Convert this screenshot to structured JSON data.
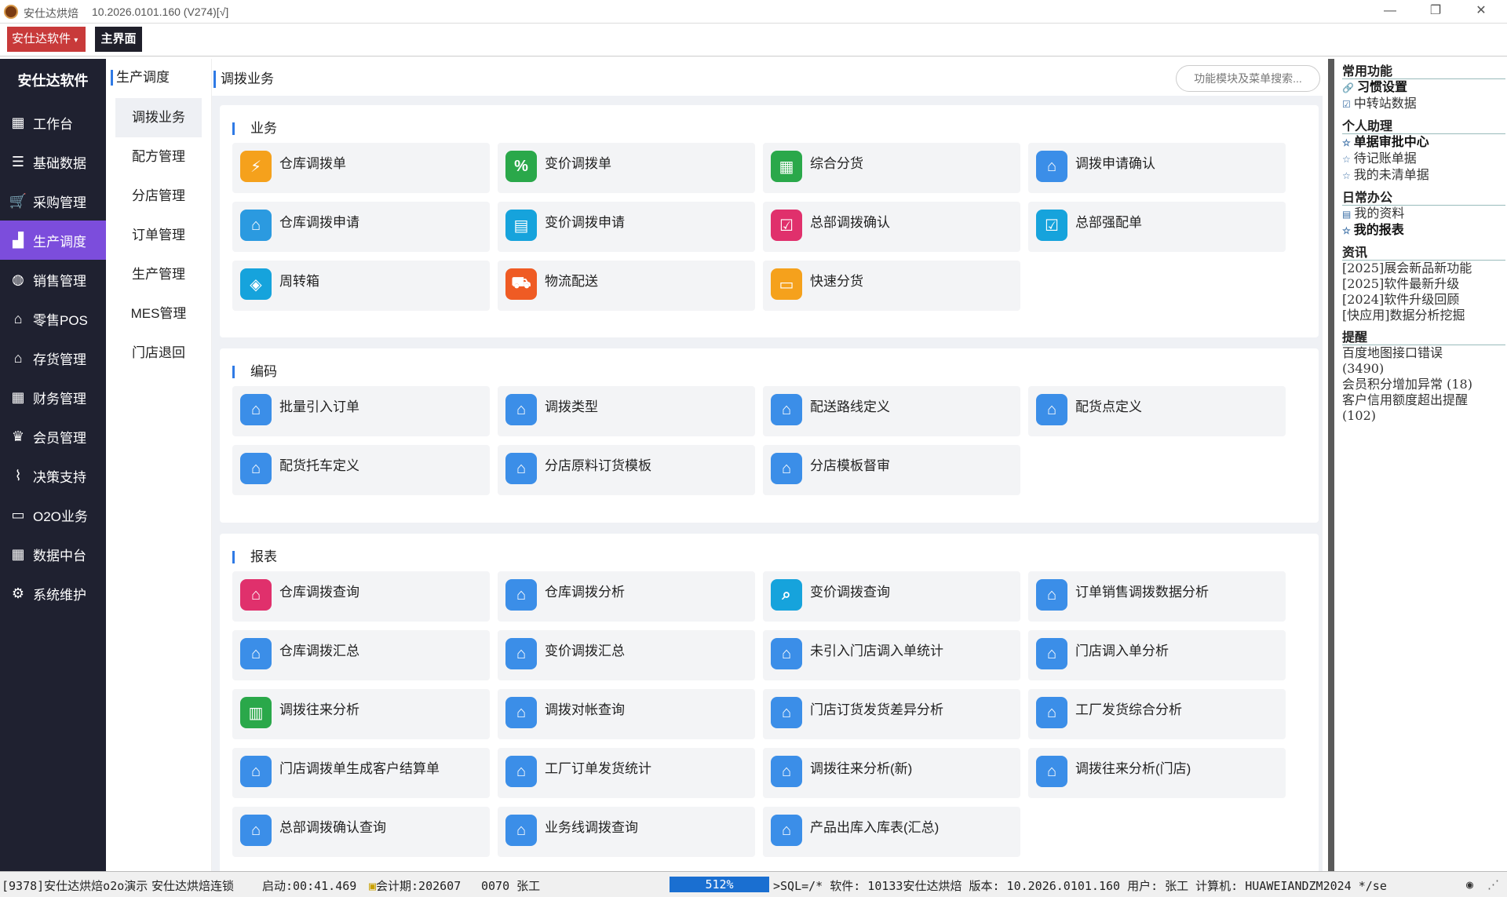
{
  "window": {
    "title": "安仕达烘焙",
    "version": "10.2026.0101.160 (V274)[√]"
  },
  "toolbar": {
    "menu_label": "安仕达软件",
    "home_tab": "主界面"
  },
  "sidebar": {
    "brand": "安仕达软件",
    "items": [
      {
        "label": "工作台",
        "icon": "grid-icon"
      },
      {
        "label": "基础数据",
        "icon": "database-icon"
      },
      {
        "label": "采购管理",
        "icon": "cart-icon"
      },
      {
        "label": "生产调度",
        "icon": "factory-icon"
      },
      {
        "label": "销售管理",
        "icon": "sale-icon"
      },
      {
        "label": "零售POS",
        "icon": "store-icon"
      },
      {
        "label": "存货管理",
        "icon": "warehouse-icon"
      },
      {
        "label": "财务管理",
        "icon": "grid-icon"
      },
      {
        "label": "会员管理",
        "icon": "crown-icon"
      },
      {
        "label": "决策支持",
        "icon": "chart-icon"
      },
      {
        "label": "O2O业务",
        "icon": "monitor-icon"
      },
      {
        "label": "数据中台",
        "icon": "grid-icon"
      },
      {
        "label": "系统维护",
        "icon": "gear-icon"
      }
    ],
    "active_color": "#7c4ddc"
  },
  "subnav": {
    "header": "生产调度",
    "items": [
      "调拨业务",
      "配方管理",
      "分店管理",
      "订单管理",
      "生产管理",
      "MES管理",
      "门店退回"
    ]
  },
  "main": {
    "header": "调拨业务",
    "search_placeholder": "功能模块及菜单搜索...",
    "sections": [
      {
        "title": "业务",
        "cards": [
          {
            "label": "仓库调拨单",
            "color": "#f5a11c",
            "glyph": "⚡"
          },
          {
            "label": "变价调拨单",
            "color": "#2aa84a",
            "glyph": "%"
          },
          {
            "label": "综合分货",
            "color": "#2aa84a",
            "glyph": "▦"
          },
          {
            "label": "调拨申请确认",
            "color": "#3b8ee8",
            "glyph": "⌂"
          },
          {
            "label": "仓库调拨申请",
            "color": "#2b9ae0",
            "glyph": "⌂"
          },
          {
            "label": "变价调拨申请",
            "color": "#16a3dc",
            "glyph": "▤"
          },
          {
            "label": "总部调拨确认",
            "color": "#e0306c",
            "glyph": "☑"
          },
          {
            "label": "总部强配单",
            "color": "#16a3dc",
            "glyph": "☑"
          },
          {
            "label": "周转箱",
            "color": "#16a3dc",
            "glyph": "◈"
          },
          {
            "label": "物流配送",
            "color": "#ef5b24",
            "glyph": "⛟"
          },
          {
            "label": "快速分货",
            "color": "#f5a11c",
            "glyph": "▭"
          }
        ]
      },
      {
        "title": "编码",
        "cards": [
          {
            "label": "批量引入订单",
            "color": "#3b8ee8",
            "glyph": "⌂"
          },
          {
            "label": "调拨类型",
            "color": "#3b8ee8",
            "glyph": "⌂"
          },
          {
            "label": "配送路线定义",
            "color": "#3b8ee8",
            "glyph": "⌂"
          },
          {
            "label": "配货点定义",
            "color": "#3b8ee8",
            "glyph": "⌂"
          },
          {
            "label": "配货托车定义",
            "color": "#3b8ee8",
            "glyph": "⌂"
          },
          {
            "label": "分店原料订货模板",
            "color": "#3b8ee8",
            "glyph": "⌂"
          },
          {
            "label": "分店模板督审",
            "color": "#3b8ee8",
            "glyph": "⌂"
          }
        ]
      },
      {
        "title": "报表",
        "cards": [
          {
            "label": "仓库调拨查询",
            "color": "#e0306c",
            "glyph": "⌂"
          },
          {
            "label": "仓库调拨分析",
            "color": "#3b8ee8",
            "glyph": "⌂"
          },
          {
            "label": "变价调拨查询",
            "color": "#16a3dc",
            "glyph": "⌕"
          },
          {
            "label": "订单销售调拨数据分析",
            "color": "#3b8ee8",
            "glyph": "⌂"
          },
          {
            "label": "仓库调拨汇总",
            "color": "#3b8ee8",
            "glyph": "⌂"
          },
          {
            "label": "变价调拨汇总",
            "color": "#3b8ee8",
            "glyph": "⌂"
          },
          {
            "label": "未引入门店调入单统计",
            "color": "#3b8ee8",
            "glyph": "⌂"
          },
          {
            "label": "门店调入单分析",
            "color": "#3b8ee8",
            "glyph": "⌂"
          },
          {
            "label": "调拨往来分析",
            "color": "#2aa84a",
            "glyph": "▥"
          },
          {
            "label": "调拨对帐查询",
            "color": "#3b8ee8",
            "glyph": "⌂"
          },
          {
            "label": "门店订货发货差异分析",
            "color": "#3b8ee8",
            "glyph": "⌂"
          },
          {
            "label": "工厂发货综合分析",
            "color": "#3b8ee8",
            "glyph": "⌂"
          },
          {
            "label": "门店调拨单生成客户结算单",
            "color": "#3b8ee8",
            "glyph": "⌂"
          },
          {
            "label": "工厂订单发货统计",
            "color": "#3b8ee8",
            "glyph": "⌂"
          },
          {
            "label": "调拨往来分析(新)",
            "color": "#3b8ee8",
            "glyph": "⌂"
          },
          {
            "label": "调拨往来分析(门店)",
            "color": "#3b8ee8",
            "glyph": "⌂"
          },
          {
            "label": "总部调拨确认查询",
            "color": "#3b8ee8",
            "glyph": "⌂"
          },
          {
            "label": "业务线调拨查询",
            "color": "#3b8ee8",
            "glyph": "⌂"
          },
          {
            "label": "产品出库入库表(汇总)",
            "color": "#3b8ee8",
            "glyph": "⌂"
          }
        ]
      }
    ]
  },
  "rightpanel": {
    "common": {
      "title": "常用功能",
      "items": [
        "习惯设置",
        "中转站数据"
      ]
    },
    "assistant": {
      "title": "个人助理",
      "items": [
        "单据审批中心",
        "待记账单据",
        "我的未清单据"
      ]
    },
    "office": {
      "title": "日常办公",
      "items": [
        "我的资料",
        "我的报表"
      ]
    },
    "news": {
      "title": "资讯",
      "items": [
        "[2025]展会新品新功能",
        "[2025]软件最新升级",
        "[2024]软件升级回顾",
        "[快应用]数据分析挖掘"
      ]
    },
    "remind": {
      "title": "提醒",
      "items": [
        "百度地图接口错误",
        "(3490)",
        "会员积分增加异常 (18)",
        "客户信用额度超出提醒",
        "(102)"
      ]
    }
  },
  "status": {
    "s1": "[9378]安仕达烘焙o2o演示",
    "s2": "安仕达烘焙连锁",
    "s3": "启动:00:41.469",
    "s4": "会计期:202607",
    "s5": "0070 张工",
    "progress_label": "512%",
    "s6": ">SQL=/* 软件: 10133安仕达烘焙 版本: 10.2026.0101.160 用户: 张工 计算机: HUAWEIANDZM2024 */se"
  }
}
